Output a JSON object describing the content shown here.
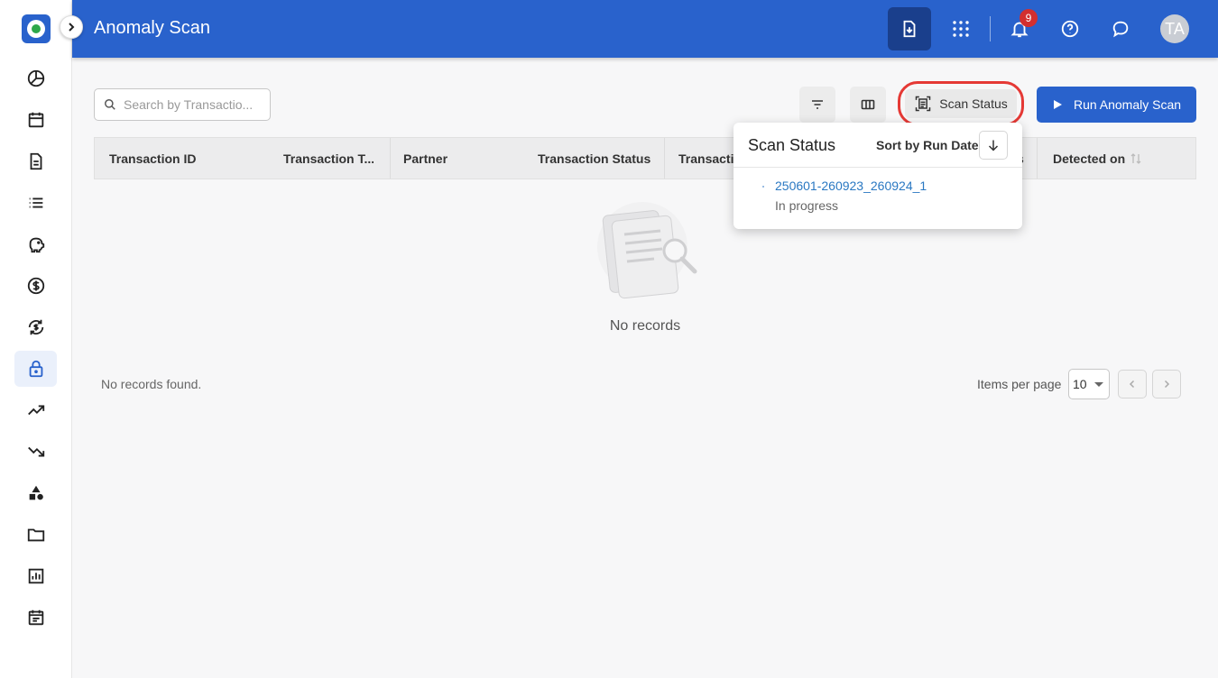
{
  "header": {
    "title": "Anomaly Scan",
    "notification_count": "9",
    "avatar_initials": "TA"
  },
  "sidebar": {
    "items": [
      {
        "icon": "pie-chart-icon"
      },
      {
        "icon": "calendar-icon"
      },
      {
        "icon": "document-icon"
      },
      {
        "icon": "list-icon"
      },
      {
        "icon": "piggy-bank-icon"
      },
      {
        "icon": "dollar-icon"
      },
      {
        "icon": "dollar-refresh-icon"
      },
      {
        "icon": "lock-icon",
        "active": true
      },
      {
        "icon": "trending-up-icon"
      },
      {
        "icon": "trending-down-icon"
      },
      {
        "icon": "shapes-icon"
      },
      {
        "icon": "folder-icon"
      },
      {
        "icon": "bar-chart-icon"
      },
      {
        "icon": "calendar-note-icon"
      }
    ]
  },
  "toolbar": {
    "search_placeholder": "Search by Transactio...",
    "scan_status_label": "Scan Status",
    "run_label": "Run Anomaly Scan"
  },
  "table": {
    "columns": [
      "Transaction ID",
      "Transaction T...",
      "Partner",
      "Transaction Status",
      "Transactio",
      "s",
      "Detected on"
    ],
    "empty_text": "No records",
    "footer_text": "No records found.",
    "items_per_page_label": "Items per page",
    "items_per_page_value": "10"
  },
  "popover": {
    "title": "Scan Status",
    "sort_label": "Sort by Run Date",
    "items": [
      {
        "id": "250601-260923_260924_1",
        "status": "In progress"
      }
    ]
  },
  "colors": {
    "brand": "#2962cc",
    "highlight": "#e53935",
    "link": "#2a78c2"
  }
}
